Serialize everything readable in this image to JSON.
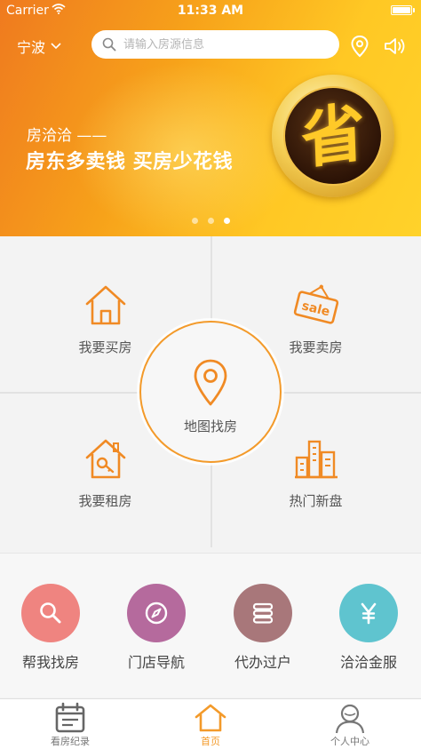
{
  "status_bar": {
    "carrier": "Carrier",
    "time": "11:33 AM"
  },
  "header": {
    "city": "宁波",
    "search_placeholder": "请输入房源信息"
  },
  "banner": {
    "subtitle": "房洽洽 ——",
    "headline": "房东多卖钱 买房少花钱",
    "badge_char": "省",
    "slide_count": 3,
    "active_slide": 3
  },
  "grid": {
    "buy": "我要买房",
    "sell": "我要卖房",
    "sell_tag": "sale",
    "rent": "我要租房",
    "new": "热门新盘",
    "map": "地图找房"
  },
  "services": [
    {
      "label": "帮我找房",
      "icon": "search-icon",
      "color": "#ef8480"
    },
    {
      "label": "门店导航",
      "icon": "compass-icon",
      "color": "#b56a9d"
    },
    {
      "label": "代办过户",
      "icon": "stack-icon",
      "color": "#a8777a"
    },
    {
      "label": "洽洽金服",
      "icon": "yen-icon",
      "color": "#5fc4cf"
    }
  ],
  "tabbar": {
    "items": [
      {
        "label": "看房纪录",
        "icon": "calendar-icon",
        "active": false
      },
      {
        "label": "首页",
        "icon": "home-icon",
        "active": true
      },
      {
        "label": "个人中心",
        "icon": "user-icon",
        "active": false
      }
    ]
  },
  "colors": {
    "accent": "#f39a2a",
    "banner_start": "#ef7a1f",
    "banner_end": "#ffd22a"
  }
}
